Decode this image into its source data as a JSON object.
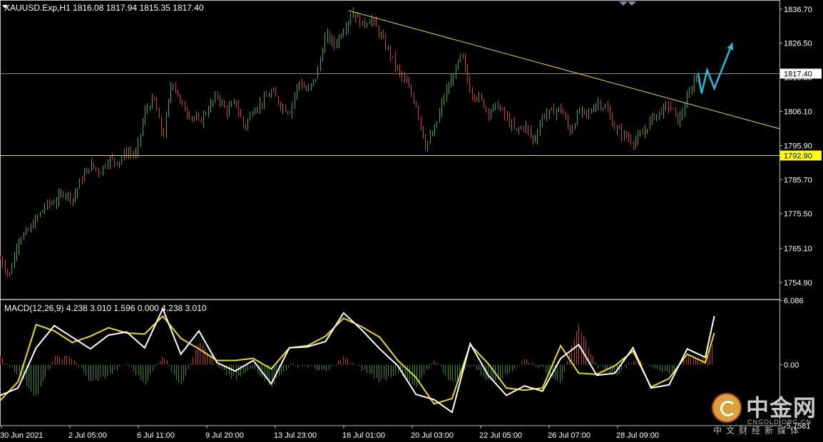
{
  "header": {
    "symbol_line": "XAUUSD.Exp,H1  1816.08 1817.94 1815.35 1817.40",
    "indicator_line": "MACD(12,26,9) 4.238 3.010 1.596 0.000 4.238 3.010"
  },
  "chart_data": [
    {
      "type": "candlestick",
      "symbol": "XAUUSD.Exp",
      "timeframe": "H1",
      "ohlc_last": {
        "open": 1816.08,
        "high": 1817.94,
        "low": 1815.35,
        "close": 1817.4
      },
      "ylim": [
        1750.0,
        1839.0
      ],
      "y_ticks": [
        "1836.70",
        "1826.50",
        "1816.30",
        "1806.10",
        "1795.90",
        "1785.70",
        "1775.50",
        "1765.10",
        "1754.90"
      ],
      "x_ticks": [
        "30 Jun 2021",
        "2 Jul 05:00",
        "6 Jul 11:00",
        "9 Jul 20:00",
        "13 Jul 23:00",
        "16 Jul 01:00",
        "20 Jul 03:00",
        "22 Jul 05:00",
        "26 Jul 07:00",
        "28 Jul 09:00"
      ],
      "price_markers": [
        {
          "label": "1817.40",
          "value": 1817.4,
          "style": "current"
        },
        {
          "label": "1792.90",
          "value": 1792.9,
          "style": "support"
        }
      ],
      "horizontal_lines": [
        {
          "value": 1817.4,
          "color": "#8a8a8a"
        },
        {
          "value": 1792.9,
          "color": "#e8e000"
        }
      ],
      "trendline": {
        "from": {
          "bar": 0.385,
          "price": 1836.3
        },
        "to": {
          "bar": 0.935,
          "price": 1795.5
        },
        "color": "#e8e000"
      },
      "projection": {
        "color": "#19c2d6",
        "points": [
          [
            0.772,
            1817.5
          ],
          [
            0.776,
            1811.5
          ],
          [
            0.782,
            1818.5
          ],
          [
            0.79,
            1813.0
          ],
          [
            0.81,
            1826.5
          ]
        ]
      },
      "close_path": [
        [
          0.0,
          1762
        ],
        [
          0.01,
          1757
        ],
        [
          0.02,
          1768
        ],
        [
          0.03,
          1770
        ],
        [
          0.04,
          1774
        ],
        [
          0.05,
          1778
        ],
        [
          0.06,
          1779
        ],
        [
          0.07,
          1782
        ],
        [
          0.08,
          1780
        ],
        [
          0.09,
          1786
        ],
        [
          0.1,
          1790
        ],
        [
          0.11,
          1788
        ],
        [
          0.12,
          1792
        ],
        [
          0.13,
          1791
        ],
        [
          0.14,
          1794
        ],
        [
          0.15,
          1793
        ],
        [
          0.16,
          1806
        ],
        [
          0.17,
          1810
        ],
        [
          0.18,
          1798
        ],
        [
          0.19,
          1816
        ],
        [
          0.2,
          1808
        ],
        [
          0.21,
          1805
        ],
        [
          0.22,
          1803
        ],
        [
          0.23,
          1807
        ],
        [
          0.24,
          1811
        ],
        [
          0.25,
          1806
        ],
        [
          0.26,
          1809
        ],
        [
          0.27,
          1801
        ],
        [
          0.28,
          1807
        ],
        [
          0.29,
          1809
        ],
        [
          0.3,
          1812
        ],
        [
          0.31,
          1808
        ],
        [
          0.32,
          1806
        ],
        [
          0.33,
          1815
        ],
        [
          0.34,
          1812
        ],
        [
          0.35,
          1817
        ],
        [
          0.36,
          1829
        ],
        [
          0.37,
          1826
        ],
        [
          0.38,
          1831
        ],
        [
          0.39,
          1836
        ],
        [
          0.4,
          1832
        ],
        [
          0.41,
          1834
        ],
        [
          0.42,
          1829
        ],
        [
          0.43,
          1824
        ],
        [
          0.44,
          1818
        ],
        [
          0.45,
          1814
        ],
        [
          0.46,
          1808
        ],
        [
          0.47,
          1796
        ],
        [
          0.48,
          1800
        ],
        [
          0.49,
          1810
        ],
        [
          0.5,
          1816
        ],
        [
          0.51,
          1823
        ],
        [
          0.52,
          1812
        ],
        [
          0.53,
          1810
        ],
        [
          0.54,
          1806
        ],
        [
          0.55,
          1808
        ],
        [
          0.56,
          1804
        ],
        [
          0.57,
          1800
        ],
        [
          0.58,
          1802
        ],
        [
          0.59,
          1797
        ],
        [
          0.6,
          1805
        ],
        [
          0.61,
          1806
        ],
        [
          0.62,
          1807
        ],
        [
          0.63,
          1800
        ],
        [
          0.64,
          1806
        ],
        [
          0.65,
          1805
        ],
        [
          0.66,
          1809
        ],
        [
          0.67,
          1807
        ],
        [
          0.68,
          1801
        ],
        [
          0.69,
          1799
        ],
        [
          0.7,
          1797
        ],
        [
          0.71,
          1799
        ],
        [
          0.72,
          1804
        ],
        [
          0.73,
          1806
        ],
        [
          0.74,
          1808
        ],
        [
          0.75,
          1803
        ],
        [
          0.76,
          1810
        ],
        [
          0.77,
          1817.4
        ]
      ]
    },
    {
      "type": "macd",
      "parameters": [
        12,
        26,
        9
      ],
      "values": {
        "macd": 4.238,
        "signal": 3.01,
        "histogram": 1.596
      },
      "y_ticks": [
        "6.086",
        "0.00",
        "-5.7581"
      ],
      "ylim": [
        -5.76,
        6.09
      ],
      "histogram_colors": {
        "positive": "#c0392b",
        "negative": "#2e8b2e"
      },
      "line_colors": {
        "macd": "#ffffff",
        "signal": "#e8e000"
      },
      "macd_path": [
        [
          0.0,
          -2.9
        ],
        [
          0.02,
          -2.2
        ],
        [
          0.04,
          1.6
        ],
        [
          0.06,
          3.7
        ],
        [
          0.08,
          2.6
        ],
        [
          0.1,
          1.5
        ],
        [
          0.12,
          2.8
        ],
        [
          0.14,
          3.1
        ],
        [
          0.16,
          1.6
        ],
        [
          0.18,
          5.3
        ],
        [
          0.2,
          1.0
        ],
        [
          0.22,
          3.2
        ],
        [
          0.24,
          0.2
        ],
        [
          0.26,
          -0.6
        ],
        [
          0.28,
          0.4
        ],
        [
          0.3,
          -1.8
        ],
        [
          0.32,
          1.6
        ],
        [
          0.34,
          1.7
        ],
        [
          0.36,
          2.2
        ],
        [
          0.38,
          4.9
        ],
        [
          0.4,
          3.3
        ],
        [
          0.42,
          1.5
        ],
        [
          0.44,
          -0.1
        ],
        [
          0.46,
          -2.8
        ],
        [
          0.48,
          -3.3
        ],
        [
          0.5,
          -4.5
        ],
        [
          0.52,
          2.0
        ],
        [
          0.54,
          -1.0
        ],
        [
          0.56,
          -2.9
        ],
        [
          0.58,
          -2.0
        ],
        [
          0.6,
          -2.5
        ],
        [
          0.62,
          0.6
        ],
        [
          0.64,
          1.9
        ],
        [
          0.66,
          -1.0
        ],
        [
          0.68,
          -0.8
        ],
        [
          0.7,
          1.6
        ],
        [
          0.72,
          -2.2
        ],
        [
          0.74,
          -1.9
        ],
        [
          0.76,
          1.5
        ],
        [
          0.78,
          0.7
        ],
        [
          0.79,
          4.6
        ]
      ],
      "signal_path": [
        [
          0.0,
          -3.4
        ],
        [
          0.02,
          -1.6
        ],
        [
          0.04,
          3.8
        ],
        [
          0.06,
          3.2
        ],
        [
          0.08,
          2.1
        ],
        [
          0.1,
          2.7
        ],
        [
          0.12,
          3.5
        ],
        [
          0.14,
          3.0
        ],
        [
          0.16,
          2.9
        ],
        [
          0.18,
          4.6
        ],
        [
          0.2,
          2.5
        ],
        [
          0.22,
          1.5
        ],
        [
          0.24,
          0.4
        ],
        [
          0.26,
          0.4
        ],
        [
          0.28,
          0.6
        ],
        [
          0.3,
          -0.4
        ],
        [
          0.32,
          1.6
        ],
        [
          0.34,
          1.8
        ],
        [
          0.36,
          2.7
        ],
        [
          0.38,
          4.4
        ],
        [
          0.4,
          3.6
        ],
        [
          0.42,
          2.6
        ],
        [
          0.44,
          0.4
        ],
        [
          0.46,
          -1.2
        ],
        [
          0.48,
          -3.7
        ],
        [
          0.5,
          -3.2
        ],
        [
          0.52,
          1.9
        ],
        [
          0.54,
          0.1
        ],
        [
          0.56,
          -2.2
        ],
        [
          0.58,
          -2.4
        ],
        [
          0.6,
          -2.2
        ],
        [
          0.62,
          1.8
        ],
        [
          0.64,
          -0.8
        ],
        [
          0.66,
          -0.9
        ],
        [
          0.68,
          -0.1
        ],
        [
          0.7,
          1.3
        ],
        [
          0.72,
          -2.1
        ],
        [
          0.74,
          -1.3
        ],
        [
          0.76,
          1.0
        ],
        [
          0.78,
          0.2
        ],
        [
          0.79,
          3.0
        ]
      ]
    }
  ],
  "watermark": {
    "cn": "中金网",
    "en": "CNGOLD.ORG.CN",
    "sub": "中文财经新媒体"
  }
}
